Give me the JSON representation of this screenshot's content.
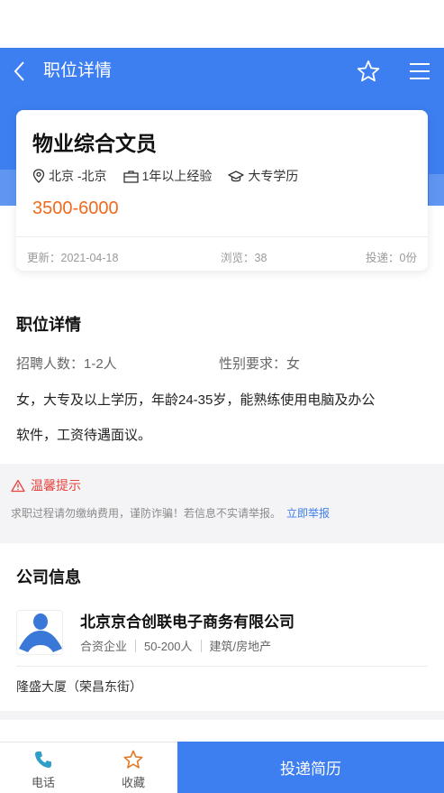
{
  "nav": {
    "title": "职位详情"
  },
  "job": {
    "title": "物业综合文员",
    "location": "北京 -北京",
    "experience": "1年以上经验",
    "education": "大专学历",
    "salary": "3500-6000",
    "updated": "更新：2021-04-18",
    "views": "浏览：38",
    "applications": "投递：0份"
  },
  "details": {
    "section_title": "职位详情",
    "headcount": "招聘人数：1-2人",
    "gender": "性别要求：女",
    "description_line1": "女，大专及以上学历，年龄24-35岁，能熟练使用电脑及办公",
    "description_line2": "软件，工资待遇面议。"
  },
  "tip": {
    "title": "温馨提示",
    "text": "求职过程请勿缴纳费用，谨防诈骗！若信息不实请举报。",
    "link": "立即举报"
  },
  "company": {
    "section_title": "公司信息",
    "name": "北京京合创联电子商务有限公司",
    "type": "合资企业",
    "size": "50-200人",
    "industry": "建筑/房地产",
    "address": "隆盛大厦（荣昌东街）"
  },
  "bottom": {
    "phone_label": "电话",
    "favorite_label": "收藏",
    "apply_label": "投递简历"
  },
  "colors": {
    "primary": "#3d7ef0",
    "salary": "#f06a1e",
    "warning": "#e8443c"
  },
  "icons": [
    "back-icon",
    "star-icon",
    "menu-icon",
    "location-icon",
    "briefcase-icon",
    "graduation-cap-icon",
    "warning-icon",
    "phone-icon",
    "star-outline-icon"
  ]
}
